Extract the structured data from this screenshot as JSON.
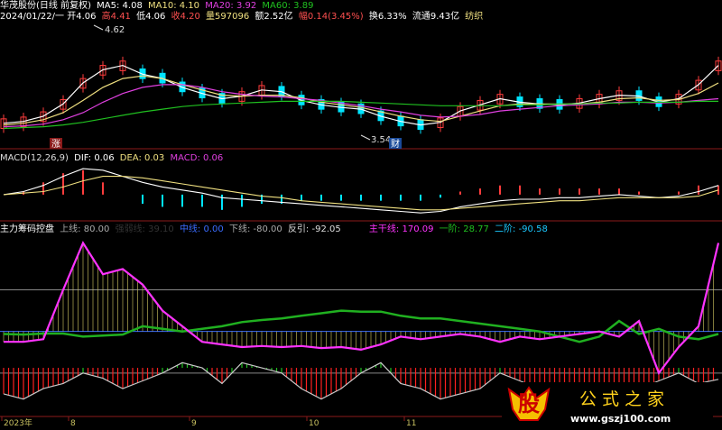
{
  "header": {
    "stock_title": "华茂股份(日线 前复权)",
    "ma5_label": "MA5: 4.08",
    "ma10_label": "MA10: 4.10",
    "ma20_label": "MA20: 3.92",
    "ma60_label": "MA60: 3.89",
    "date": "2024/01/22/一",
    "open": "开4.06",
    "high": "高4.41",
    "low": "低4.06",
    "close": "收4.20",
    "volume": "量597096",
    "amount": "额2.52亿",
    "change": "幅0.14(3.45%)",
    "turnover": "换6.33%",
    "float_cap": "流通9.43亿",
    "sector": "纺织"
  },
  "markers": {
    "high_price": "4.62",
    "low_price": "3.54",
    "zhang": "涨",
    "cai": "财"
  },
  "macd_header": {
    "name": "MACD(12,26,9)",
    "dif": "DIF: 0.06",
    "dea": "DEA: 0.03",
    "macd": "MACD: 0.06"
  },
  "ind_header": {
    "name": "主力筹码控盘",
    "upper": "上线: 80.00",
    "mid_series": "强弱线: 39.10",
    "center": "中线: 0.00",
    "lower": "下线: -80.00",
    "reverse": "反引: -92.05",
    "main": "主干线: 170.09",
    "stage1": "一阶: 28.77",
    "stage2": "二阶: -90.58"
  },
  "x_axis": {
    "year": "2023年",
    "m8": "8",
    "m9": "9",
    "m10": "10",
    "m11": "11"
  },
  "watermark": {
    "logo": "股",
    "title": "公式之家",
    "url": "www.gszj100.com"
  },
  "colors": {
    "up": "#ff3c3c",
    "down": "#00e5ff",
    "ma5": "#ffffff",
    "ma10": "#f0e080",
    "ma20": "#e040e0",
    "ma60": "#20c020",
    "dif": "#ffffff",
    "dea": "#f0e080",
    "main_line": "#ff33ff",
    "strength_line": "#20b020",
    "reverse_line": "#c8c8c8"
  },
  "chart_data": [
    {
      "type": "line",
      "title": "华茂股份(日线 前复权)",
      "series": [
        {
          "name": "MA5",
          "values": [
            3.64,
            3.66,
            3.72,
            3.86,
            4.1,
            4.25,
            4.3,
            4.2,
            4.15,
            4.05,
            3.98,
            3.92,
            3.95,
            4.02,
            4.0,
            3.9,
            3.85,
            3.82,
            3.8,
            3.72,
            3.66,
            3.62,
            3.65,
            3.78,
            3.85,
            3.92,
            3.88,
            3.86,
            3.85,
            3.87,
            3.92,
            3.96,
            3.95,
            3.88,
            3.92,
            4.08,
            4.3
          ]
        },
        {
          "name": "MA10",
          "values": [
            3.62,
            3.64,
            3.68,
            3.76,
            3.9,
            4.05,
            4.15,
            4.18,
            4.15,
            4.08,
            4.02,
            3.96,
            3.95,
            3.96,
            3.96,
            3.93,
            3.88,
            3.85,
            3.82,
            3.77,
            3.72,
            3.68,
            3.66,
            3.72,
            3.78,
            3.84,
            3.86,
            3.86,
            3.86,
            3.86,
            3.88,
            3.92,
            3.93,
            3.9,
            3.91,
            3.98,
            4.1
          ]
        },
        {
          "name": "MA20",
          "values": [
            3.6,
            3.61,
            3.63,
            3.68,
            3.76,
            3.88,
            3.98,
            4.05,
            4.08,
            4.08,
            4.05,
            4.0,
            3.97,
            3.95,
            3.94,
            3.92,
            3.9,
            3.87,
            3.84,
            3.8,
            3.77,
            3.73,
            3.71,
            3.72,
            3.74,
            3.78,
            3.8,
            3.82,
            3.84,
            3.85,
            3.86,
            3.88,
            3.88,
            3.87,
            3.88,
            3.9,
            3.92
          ]
        },
        {
          "name": "MA60",
          "values": [
            3.58,
            3.59,
            3.6,
            3.62,
            3.65,
            3.69,
            3.73,
            3.77,
            3.8,
            3.83,
            3.85,
            3.86,
            3.87,
            3.88,
            3.89,
            3.89,
            3.89,
            3.89,
            3.88,
            3.87,
            3.86,
            3.85,
            3.84,
            3.84,
            3.84,
            3.84,
            3.85,
            3.85,
            3.86,
            3.86,
            3.87,
            3.87,
            3.88,
            3.88,
            3.88,
            3.89,
            3.89
          ]
        }
      ]
    },
    {
      "type": "bar",
      "title": "MACD(12,26,9)",
      "series": [
        {
          "name": "DIF",
          "values": [
            0.0,
            0.02,
            0.06,
            0.12,
            0.17,
            0.16,
            0.12,
            0.08,
            0.05,
            0.03,
            0.01,
            -0.02,
            -0.03,
            -0.04,
            -0.05,
            -0.06,
            -0.07,
            -0.08,
            -0.09,
            -0.1,
            -0.11,
            -0.12,
            -0.11,
            -0.08,
            -0.06,
            -0.04,
            -0.03,
            -0.03,
            -0.02,
            -0.02,
            -0.01,
            0.0,
            -0.01,
            -0.02,
            -0.01,
            0.02,
            0.06
          ]
        },
        {
          "name": "DEA",
          "values": [
            0.0,
            0.01,
            0.02,
            0.05,
            0.09,
            0.12,
            0.12,
            0.11,
            0.09,
            0.07,
            0.05,
            0.03,
            0.01,
            -0.01,
            -0.02,
            -0.04,
            -0.05,
            -0.06,
            -0.07,
            -0.08,
            -0.09,
            -0.1,
            -0.1,
            -0.09,
            -0.08,
            -0.07,
            -0.06,
            -0.05,
            -0.04,
            -0.04,
            -0.03,
            -0.02,
            -0.02,
            -0.02,
            -0.02,
            -0.01,
            0.03
          ]
        },
        {
          "name": "MACD",
          "values": [
            0.0,
            0.02,
            0.08,
            0.14,
            0.16,
            0.08,
            0.0,
            -0.06,
            -0.08,
            -0.08,
            -0.08,
            -0.1,
            -0.08,
            -0.06,
            -0.06,
            -0.04,
            -0.04,
            -0.04,
            -0.04,
            -0.04,
            -0.04,
            -0.04,
            -0.02,
            0.02,
            0.04,
            0.06,
            0.06,
            0.04,
            0.04,
            0.04,
            0.04,
            0.04,
            0.02,
            0.0,
            0.02,
            0.06,
            0.06
          ]
        }
      ]
    },
    {
      "type": "line",
      "title": "主力筹码控盘",
      "series": [
        {
          "name": "主干线",
          "values": [
            -20,
            -20,
            -15,
            80,
            170,
            110,
            120,
            90,
            40,
            10,
            -20,
            -25,
            -30,
            -28,
            -30,
            -28,
            -32,
            -30,
            -35,
            -25,
            -10,
            -15,
            -10,
            -5,
            -10,
            -20,
            -10,
            -15,
            -10,
            -5,
            0,
            -10,
            20,
            -80,
            -30,
            10,
            170
          ]
        },
        {
          "name": "强弱线",
          "values": [
            -5,
            -6,
            -4,
            -4,
            -10,
            -8,
            -6,
            10,
            5,
            0,
            5,
            10,
            18,
            22,
            25,
            30,
            35,
            40,
            38,
            38,
            30,
            25,
            25,
            20,
            15,
            10,
            5,
            0,
            -10,
            -20,
            -10,
            20,
            -5,
            5,
            -10,
            -15,
            -5
          ]
        },
        {
          "name": "反引",
          "values": [
            -120,
            -130,
            -110,
            -100,
            -80,
            -90,
            -110,
            -95,
            -80,
            -60,
            -70,
            -100,
            -60,
            -70,
            -80,
            -110,
            -130,
            -110,
            -80,
            -60,
            -100,
            -110,
            -130,
            -120,
            -110,
            -80,
            -95,
            -110,
            -130,
            -140,
            -150,
            -145,
            -110,
            -95,
            -80,
            -100,
            -92
          ]
        }
      ],
      "reference_lines": {
        "上线": 80,
        "中线": 0,
        "下线": -80
      }
    }
  ]
}
